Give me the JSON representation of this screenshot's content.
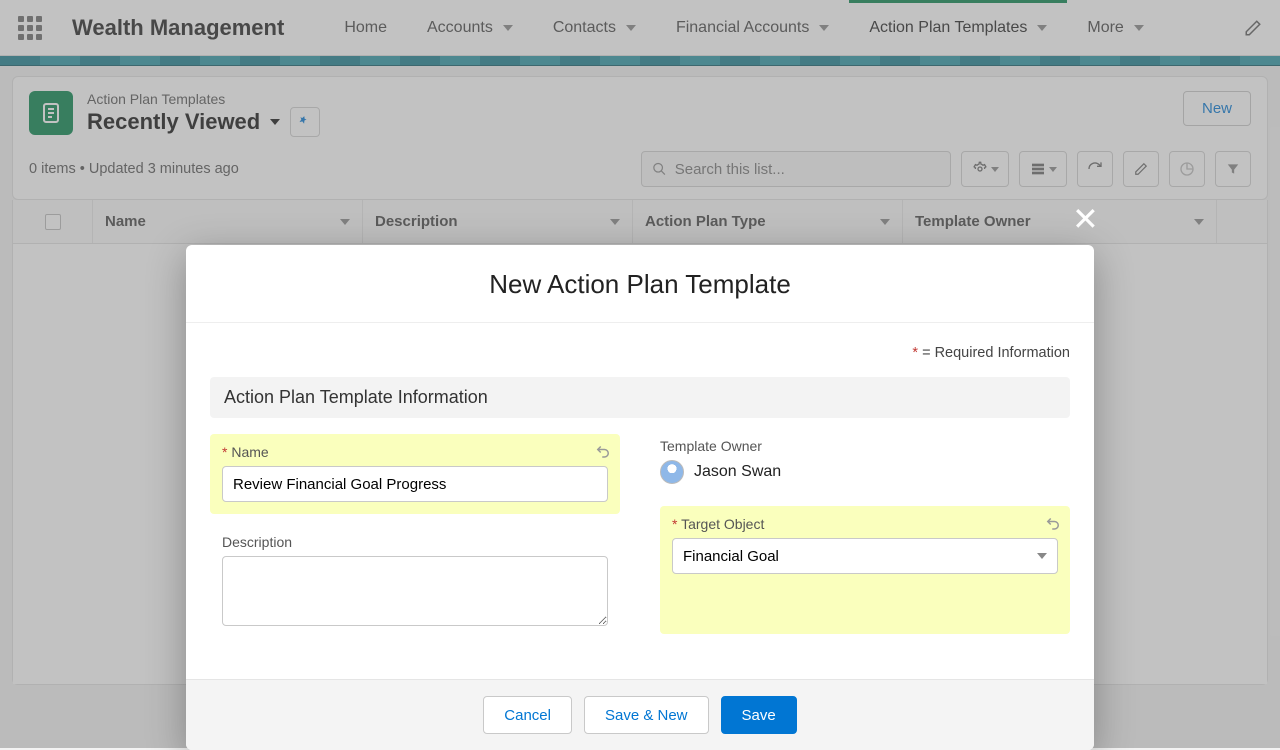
{
  "app_title": "Wealth Management",
  "nav": {
    "home": "Home",
    "accounts": "Accounts",
    "contacts": "Contacts",
    "financial_accounts": "Financial Accounts",
    "action_plan_templates": "Action Plan Templates",
    "more": "More"
  },
  "page": {
    "object_label": "Action Plan Templates",
    "view_name": "Recently Viewed",
    "meta": "0 items • Updated 3 minutes ago",
    "search_placeholder": "Search this list...",
    "new_button": "New"
  },
  "columns": {
    "name": "Name",
    "description": "Description",
    "type": "Action Plan Type",
    "owner": "Template Owner"
  },
  "modal": {
    "title": "New Action Plan Template",
    "required_note": " = Required Information",
    "section": "Action Plan Template Information",
    "name_label": "Name",
    "name_value": "Review Financial Goal Progress",
    "description_label": "Description",
    "description_value": "",
    "owner_label": "Template Owner",
    "owner_value": "Jason Swan",
    "target_label": "Target Object",
    "target_value": "Financial Goal",
    "cancel": "Cancel",
    "save_new": "Save & New",
    "save": "Save"
  }
}
